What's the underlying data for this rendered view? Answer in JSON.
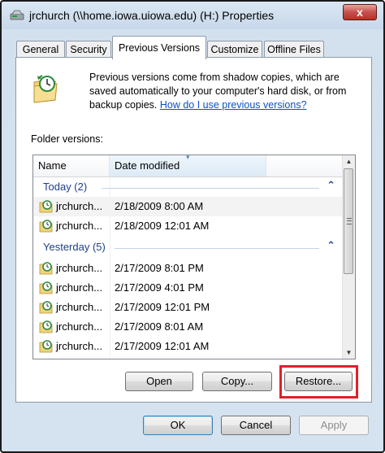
{
  "window": {
    "title": "jrchurch (\\\\home.iowa.uiowa.edu) (H:) Properties",
    "close_label": "x"
  },
  "tabs": [
    {
      "label": "General",
      "active": false
    },
    {
      "label": "Security",
      "active": false
    },
    {
      "label": "Previous Versions",
      "active": true
    },
    {
      "label": "Customize",
      "active": false
    },
    {
      "label": "Offline Files",
      "active": false
    }
  ],
  "panel": {
    "description": "Previous versions come from shadow copies, which are saved automatically to your computer's hard disk, or from backup copies.",
    "help_link": "How do I use previous versions?",
    "folder_versions_label": "Folder versions:"
  },
  "list": {
    "columns": {
      "name": "Name",
      "date": "Date modified"
    },
    "groups": [
      {
        "label": "Today (2)",
        "rows": [
          {
            "name": "jrchurch...",
            "date": "2/18/2009 8:00 AM",
            "selected": true
          },
          {
            "name": "jrchurch...",
            "date": "2/18/2009 12:01 AM",
            "selected": false
          }
        ]
      },
      {
        "label": "Yesterday (5)",
        "rows": [
          {
            "name": "jrchurch...",
            "date": "2/17/2009 8:01 PM",
            "selected": false
          },
          {
            "name": "jrchurch...",
            "date": "2/17/2009 4:01 PM",
            "selected": false
          },
          {
            "name": "jrchurch...",
            "date": "2/17/2009 12:01 PM",
            "selected": false
          },
          {
            "name": "jrchurch...",
            "date": "2/17/2009 8:01 AM",
            "selected": false
          },
          {
            "name": "jrchurch...",
            "date": "2/17/2009 12:01 AM",
            "selected": false
          }
        ]
      }
    ]
  },
  "actions": {
    "open": "Open",
    "copy": "Copy...",
    "restore": "Restore..."
  },
  "dialog_buttons": {
    "ok": "OK",
    "cancel": "Cancel",
    "apply": "Apply"
  },
  "colors": {
    "highlight": "#e0202a",
    "group_header": "#1e3f87",
    "link": "#0b4fd1"
  }
}
